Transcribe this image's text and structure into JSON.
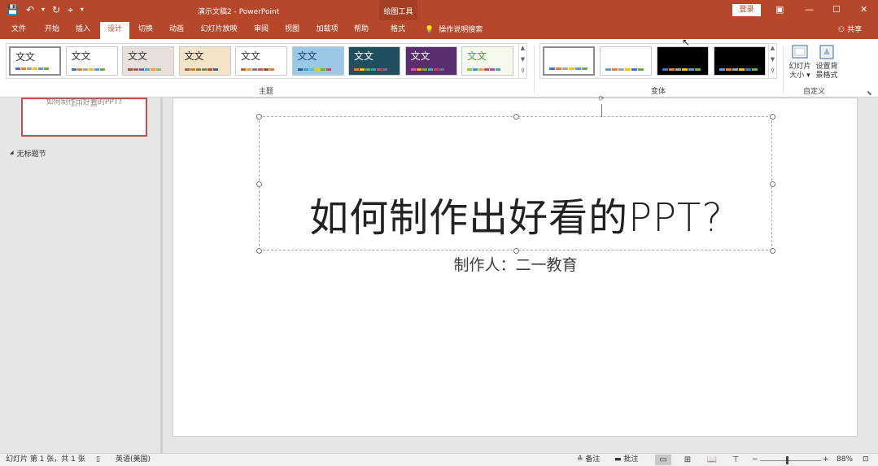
{
  "titlebar": {
    "qat": [
      "💾",
      "↶",
      "▾",
      "↻",
      "⌖",
      "▾"
    ],
    "doc_title": "演示文稿2  -  PowerPoint",
    "context_label": "绘图工具",
    "login": "登录",
    "ribbon_display_icon": "▣",
    "minimize": "—",
    "maximize": "☐",
    "close": "✕"
  },
  "tabs": [
    {
      "label": "文件"
    },
    {
      "label": "开始"
    },
    {
      "label": "插入"
    },
    {
      "label": "设计"
    },
    {
      "label": "切换"
    },
    {
      "label": "动画"
    },
    {
      "label": "幻灯片放映"
    },
    {
      "label": "审阅"
    },
    {
      "label": "视图"
    },
    {
      "label": "加载项"
    },
    {
      "label": "帮助"
    },
    {
      "label": "格式"
    }
  ],
  "active_tab": "设计",
  "tell_me": {
    "icon": "lightbulb-icon",
    "glyph": "💡",
    "label": "操作说明搜索"
  },
  "share": {
    "icon": "person-icon",
    "glyph": "⚇",
    "label": "共享"
  },
  "ribbon": {
    "themes_label": "主题",
    "variants_label": "变体",
    "customize_label": "自定义",
    "themes": [
      {
        "text": "文文",
        "bg": "#ffffff",
        "fg": "#333333",
        "colors": [
          "#4472c4",
          "#ed7d31",
          "#a5a5a5",
          "#ffc000",
          "#5b9bd5",
          "#70ad47"
        ]
      },
      {
        "text": "文文",
        "bg": "#ffffff",
        "fg": "#333333",
        "colors": [
          "#4472c4",
          "#ed7d31",
          "#a5a5a5",
          "#ffc000",
          "#5b9bd5",
          "#70ad47"
        ]
      },
      {
        "text": "文文",
        "bg": "#e8e0dc",
        "fg": "#333333",
        "colors": [
          "#9c5a40",
          "#c0504d",
          "#8064a2",
          "#4bacc6",
          "#f79646",
          "#9bbb59"
        ]
      },
      {
        "text": "文文",
        "bg": "#f4e4c8",
        "fg": "#222222",
        "colors": [
          "#a5644e",
          "#d07a2a",
          "#8e7a5b",
          "#6b8e5a",
          "#c44a2a",
          "#3e6a8a"
        ]
      },
      {
        "text": "文文",
        "bg": "#ffffff",
        "fg": "#333333",
        "colors": [
          "#d35b2a",
          "#f2a03d",
          "#7f7f7f",
          "#d9534f",
          "#a0522d",
          "#e07b39"
        ]
      },
      {
        "text": "文文",
        "bg": "#9cc8e8",
        "fg": "#1f3f6f",
        "colors": [
          "#2f5597",
          "#3a9fd8",
          "#5fb8e8",
          "#f2c811",
          "#70ad47",
          "#c0504d"
        ]
      },
      {
        "text": "文文",
        "bg": "#1f4e5f",
        "fg": "#ffffff",
        "colors": [
          "#e07b39",
          "#f2c811",
          "#70ad47",
          "#2ea3c8",
          "#c0504d",
          "#8064a2"
        ]
      },
      {
        "text": "文文",
        "bg": "#5a2d6e",
        "fg": "#ffffff",
        "colors": [
          "#e8509a",
          "#f2a03d",
          "#70ad47",
          "#4bacc6",
          "#c0504d",
          "#8064a2"
        ]
      },
      {
        "text": "文文",
        "bg": "#f6f9ee",
        "fg": "#5a9a2a",
        "colors": [
          "#8dc63f",
          "#2ea3c8",
          "#f2a03d",
          "#c0504d",
          "#8064a2",
          "#5b9bd5"
        ]
      }
    ],
    "variants": [
      {
        "bg": "#ffffff",
        "colors": [
          "#4472c4",
          "#ed7d31",
          "#a5a5a5",
          "#ffc000",
          "#5b9bd5",
          "#70ad47"
        ]
      },
      {
        "bg": "#ffffff",
        "colors": [
          "#5b9bd5",
          "#ed7d31",
          "#a5a5a5",
          "#ffc000",
          "#4472c4",
          "#70ad47"
        ]
      },
      {
        "bg": "#000000",
        "colors": [
          "#4472c4",
          "#ed7d31",
          "#a5a5a5",
          "#ffc000",
          "#5b9bd5",
          "#70ad47"
        ]
      },
      {
        "bg": "#000000",
        "colors": [
          "#5b9bd5",
          "#ed7d31",
          "#a5a5a5",
          "#ffc000",
          "#4472c4",
          "#70ad47"
        ]
      }
    ],
    "slide_size": {
      "line1": "幻灯片",
      "line2": "大小 ▾"
    },
    "format_background": {
      "line1": "设置背",
      "line2": "景格式"
    }
  },
  "thumb_pane": {
    "slide_title": "如何制作出好看的PPT?",
    "slide_subtitle": "制作人：二一教育",
    "section_arrow": "◢",
    "section_label": "无标题节"
  },
  "slide": {
    "title": "如何制作出好看的PPT?",
    "subtitle": "制作人：二一教育"
  },
  "statusbar": {
    "slide_info": "幻灯片 第 1 张，共 1 张",
    "spell_icon": "▯",
    "language": "英语(美国)",
    "notes": "≙ 备注",
    "comments": "▬ 批注",
    "zoom_minus": "−",
    "zoom_plus": "+",
    "zoom": "88%",
    "fit_icon": "⊡"
  }
}
